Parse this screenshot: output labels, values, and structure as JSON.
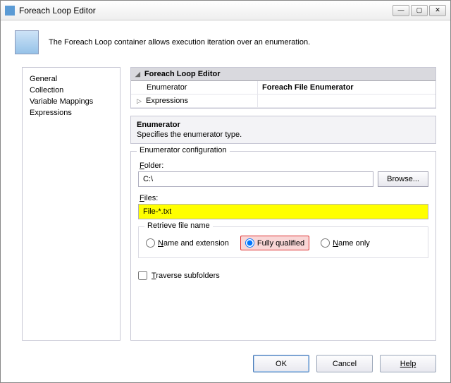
{
  "window": {
    "title": "Foreach Loop Editor"
  },
  "header": {
    "description": "The Foreach Loop container allows execution iteration over an enumeration."
  },
  "nav": {
    "items": [
      "General",
      "Collection",
      "Variable Mappings",
      "Expressions"
    ]
  },
  "propgrid": {
    "header": "Foreach Loop Editor",
    "rows": [
      {
        "label": "Enumerator",
        "value": "Foreach File Enumerator"
      },
      {
        "label": "Expressions",
        "value": ""
      }
    ]
  },
  "descpane": {
    "title": "Enumerator",
    "text": "Specifies the enumerator type."
  },
  "config": {
    "legend": "Enumerator configuration",
    "folder_label": "Folder:",
    "folder_value": "C:\\",
    "browse_label": "Browse...",
    "files_label": "Files:",
    "files_value": "File-*.txt",
    "retrieve_legend": "Retrieve file name",
    "radios": {
      "name_ext": "Name and extension",
      "fully": "Fully qualified",
      "name_only": "Name only"
    },
    "traverse_label": "Traverse subfolders"
  },
  "footer": {
    "ok": "OK",
    "cancel": "Cancel",
    "help": "Help"
  }
}
